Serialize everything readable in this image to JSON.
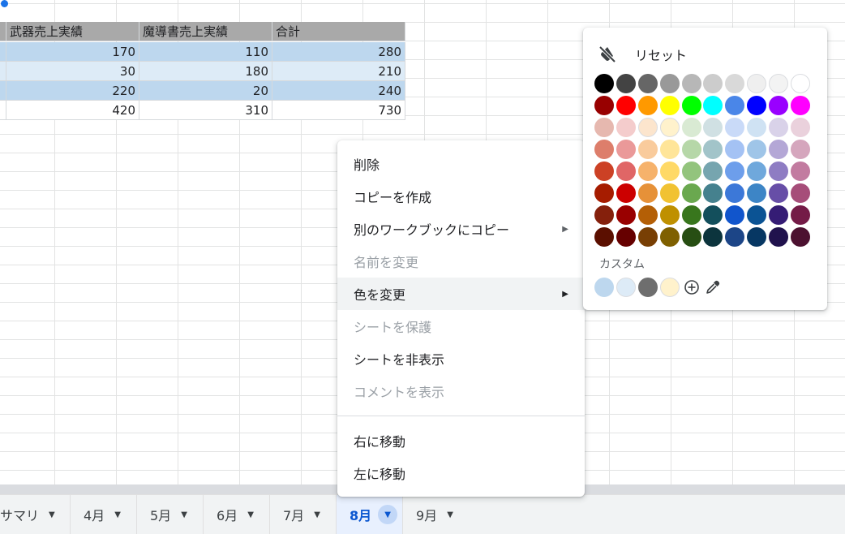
{
  "table": {
    "headers": [
      "武器売上実績",
      "魔導書売上実績",
      "合計"
    ],
    "rows": [
      [
        "170",
        "110",
        "280"
      ],
      [
        "30",
        "180",
        "210"
      ],
      [
        "220",
        "20",
        "240"
      ],
      [
        "420",
        "310",
        "730"
      ]
    ]
  },
  "context_menu": {
    "items": [
      {
        "label": "削除",
        "disabled": false
      },
      {
        "label": "コピーを作成",
        "disabled": false
      },
      {
        "label": "別のワークブックにコピー",
        "disabled": false,
        "submenu": true
      },
      {
        "label": "名前を変更",
        "disabled": true
      },
      {
        "label": "色を変更",
        "disabled": false,
        "submenu": true,
        "highlighted": true
      },
      {
        "label": "シートを保護",
        "disabled": true
      },
      {
        "label": "シートを非表示",
        "disabled": false
      },
      {
        "label": "コメントを表示",
        "disabled": true
      },
      {
        "label": "右に移動",
        "disabled": false
      },
      {
        "label": "左に移動",
        "disabled": false
      }
    ]
  },
  "palette": {
    "reset_label": "リセット",
    "custom_label": "カスタム",
    "colors": [
      [
        "#000000",
        "#434343",
        "#666666",
        "#999999",
        "#b7b7b7",
        "#cccccc",
        "#d9d9d9",
        "#efefef",
        "#f3f3f3",
        "#ffffff"
      ],
      [
        "#980000",
        "#ff0000",
        "#ff9900",
        "#ffff00",
        "#00ff00",
        "#00ffff",
        "#4a86e8",
        "#0000ff",
        "#9900ff",
        "#ff00ff"
      ],
      [
        "#e6b8af",
        "#f4cccc",
        "#fce5cd",
        "#fff2cc",
        "#d9ead3",
        "#d0e0e3",
        "#c9daf8",
        "#cfe2f3",
        "#d9d2e9",
        "#ead1dc"
      ],
      [
        "#dd7e6b",
        "#ea9999",
        "#f9cb9c",
        "#ffe599",
        "#b6d7a8",
        "#a2c4c9",
        "#a4c2f4",
        "#9fc5e8",
        "#b4a7d6",
        "#d5a6bd"
      ],
      [
        "#cc4125",
        "#e06666",
        "#f6b26b",
        "#ffd966",
        "#93c47d",
        "#76a5af",
        "#6d9eeb",
        "#6fa8dc",
        "#8e7cc3",
        "#c27ba0"
      ],
      [
        "#a61c00",
        "#cc0000",
        "#e69138",
        "#f1c232",
        "#6aa84f",
        "#45818e",
        "#3c78d8",
        "#3d85c6",
        "#674ea7",
        "#a64d79"
      ],
      [
        "#85200c",
        "#990000",
        "#b45f06",
        "#bf9000",
        "#38761d",
        "#134f5c",
        "#1155cc",
        "#0b5394",
        "#351c75",
        "#741b47"
      ],
      [
        "#5b0f00",
        "#660000",
        "#783f04",
        "#7f6000",
        "#274e13",
        "#0c343d",
        "#1c4587",
        "#073763",
        "#20124d",
        "#4c1130"
      ]
    ],
    "custom_colors": [
      "#bdd7ee",
      "#ddebf7",
      "#6e6e6e",
      "#fff2cc"
    ]
  },
  "tabs": [
    {
      "label": "サマリ",
      "active": false
    },
    {
      "label": "4月",
      "active": false
    },
    {
      "label": "5月",
      "active": false
    },
    {
      "label": "6月",
      "active": false
    },
    {
      "label": "7月",
      "active": false
    },
    {
      "label": "8月",
      "active": true
    },
    {
      "label": "9月",
      "active": false
    }
  ]
}
